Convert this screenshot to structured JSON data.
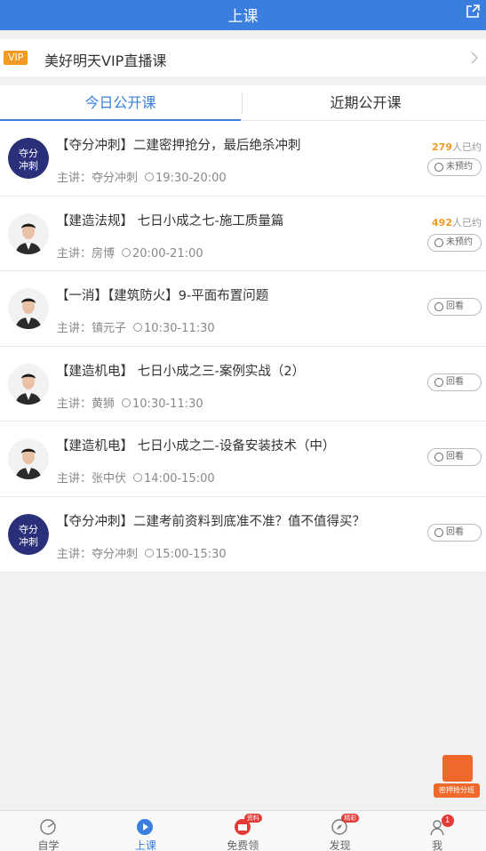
{
  "header": {
    "title": "上课"
  },
  "vip": {
    "badge": "VIP",
    "text": "美好明天VIP直播课"
  },
  "tabs": [
    {
      "label": "今日公开课"
    },
    {
      "label": "近期公开课"
    }
  ],
  "courses": [
    {
      "title": "【夺分冲刺】二建密押抢分，最后绝杀冲刺",
      "lecturer": "主讲：夺分冲刺",
      "time": "19:30-20:00",
      "count": "279",
      "count_suffix": "人已约",
      "button": "未预约",
      "avatar": "logo"
    },
    {
      "title": "【建造法规】 七日小成之七-施工质量篇",
      "lecturer": "主讲：房博",
      "time": "20:00-21:00",
      "count": "492",
      "count_suffix": "人已约",
      "button": "未预约",
      "avatar": "person"
    },
    {
      "title": "【一消】【建筑防火】9-平面布置问题",
      "lecturer": "主讲：镇元子",
      "time": "10:30-11:30",
      "button": "回看",
      "avatar": "person"
    },
    {
      "title": "【建造机电】 七日小成之三-案例实战（2）",
      "lecturer": "主讲：黄狮",
      "time": "10:30-11:30",
      "button": "回看",
      "avatar": "person"
    },
    {
      "title": "【建造机电】 七日小成之二-设备安装技术（中）",
      "lecturer": "主讲：张中伏",
      "time": "14:00-15:00",
      "button": "回看",
      "avatar": "person"
    },
    {
      "title": "【夺分冲刺】二建考前资料到底准不准？值不值得买？",
      "lecturer": "主讲：夺分冲刺",
      "time": "15:00-15:30",
      "button": "回看",
      "avatar": "logo"
    }
  ],
  "logo_text": [
    "夺分",
    "冲刺"
  ],
  "float_promo": {
    "label": "密押抢分班"
  },
  "tabbar": [
    {
      "label": "自学",
      "icon": "self-study-icon"
    },
    {
      "label": "上课",
      "icon": "play-icon"
    },
    {
      "label": "免费领",
      "icon": "gift-icon",
      "tag": "资料"
    },
    {
      "label": "发现",
      "icon": "compass-icon",
      "tag": "精彩"
    },
    {
      "label": "我",
      "icon": "user-icon",
      "badge": "1"
    }
  ],
  "colors": {
    "primary": "#3a7fdf",
    "accent": "#f39a24",
    "badge": "#e53935"
  }
}
